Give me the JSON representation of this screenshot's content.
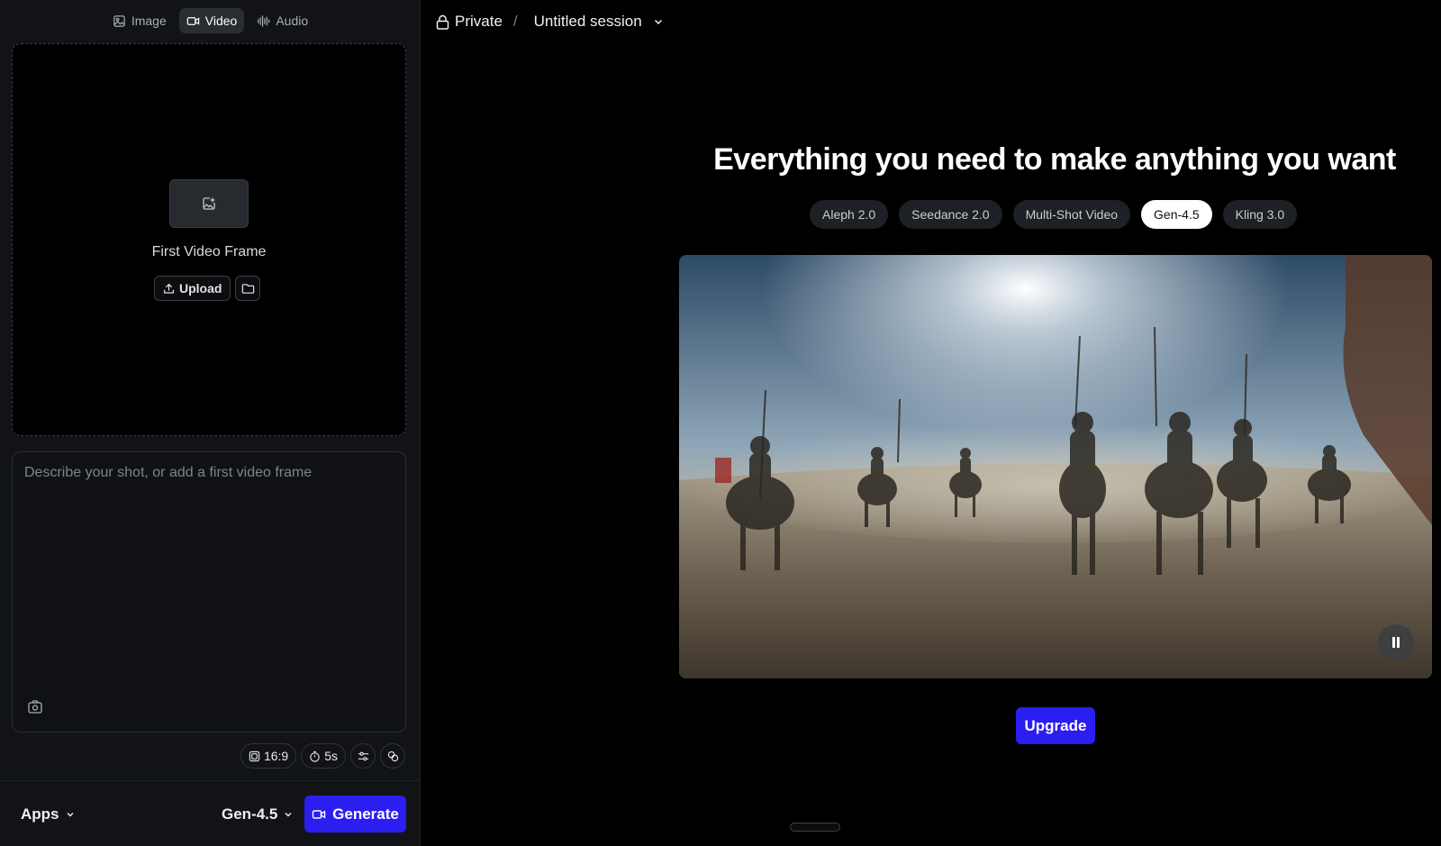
{
  "modes": [
    {
      "label": "Image",
      "icon": "image-icon",
      "active": false
    },
    {
      "label": "Video",
      "icon": "video-icon",
      "active": true
    },
    {
      "label": "Audio",
      "icon": "audio-waveform-icon",
      "active": false
    }
  ],
  "dropzone": {
    "label": "First Video Frame",
    "upload_label": "Upload"
  },
  "prompt": {
    "placeholder": "Describe your shot, or add a first video frame",
    "value": ""
  },
  "settings": {
    "aspect_ratio": "16:9",
    "duration": "5s"
  },
  "bottom": {
    "apps_label": "Apps",
    "model_label": "Gen-4.5",
    "generate_label": "Generate"
  },
  "breadcrumb": {
    "visibility": "Private",
    "separator": "/",
    "session": "Untitled session"
  },
  "main": {
    "headline": "Everything you need to make anything you want",
    "model_tabs": [
      {
        "label": "Aleph 2.0",
        "active": false
      },
      {
        "label": "Seedance 2.0",
        "active": false
      },
      {
        "label": "Multi-Shot Video",
        "active": false
      },
      {
        "label": "Gen-4.5",
        "active": true
      },
      {
        "label": "Kling 3.0",
        "active": false
      }
    ],
    "upgrade_label": "Upgrade"
  },
  "colors": {
    "accent": "#2b1ef0",
    "panel": "#111316",
    "background": "#000000"
  }
}
